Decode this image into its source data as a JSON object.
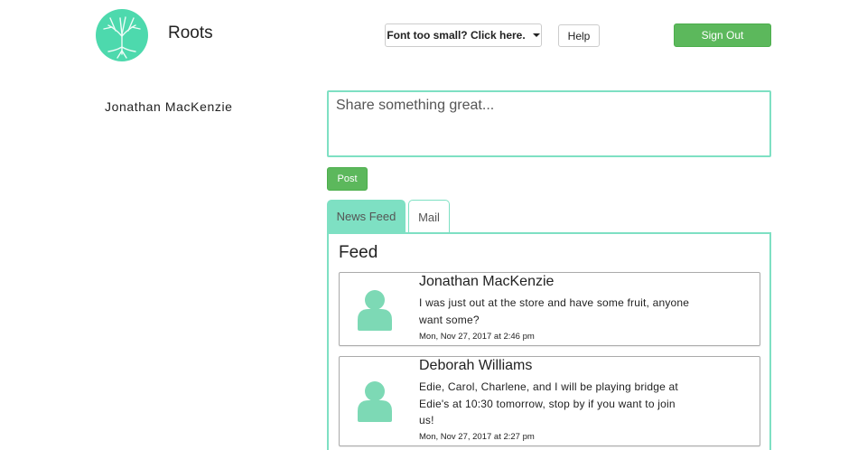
{
  "header": {
    "app_title": "Roots",
    "font_button_label": "Font too small? Click here.",
    "help_label": "Help",
    "signout_label": "Sign Out"
  },
  "profile": {
    "name": "Jonathan MacKenzie"
  },
  "composer": {
    "placeholder": "Share something great...",
    "post_label": "Post"
  },
  "tabs": [
    {
      "label": "News Feed",
      "active": true
    },
    {
      "label": "Mail",
      "active": false
    }
  ],
  "feed": {
    "title": "Feed",
    "posts": [
      {
        "author": "Jonathan MacKenzie",
        "body": "I was just out at the store and have some fruit, anyone want some?",
        "time": "Mon, Nov 27, 2017 at 2:46 pm"
      },
      {
        "author": "Deborah Williams",
        "body": "Edie, Carol, Charlene, and I will be playing bridge at Edie's at 10:30 tomorrow, stop by if you want to join us!",
        "time": "Mon, Nov 27, 2017 at 2:27 pm"
      }
    ]
  },
  "colors": {
    "accent": "#7ee0c3",
    "primary_button": "#5cb85c",
    "logo": "#4dd9ad",
    "avatar": "#7dd9b5"
  },
  "icons": {
    "logo": "tree-logo-icon",
    "caret": "caret-down-icon",
    "avatar": "user-avatar-icon"
  }
}
